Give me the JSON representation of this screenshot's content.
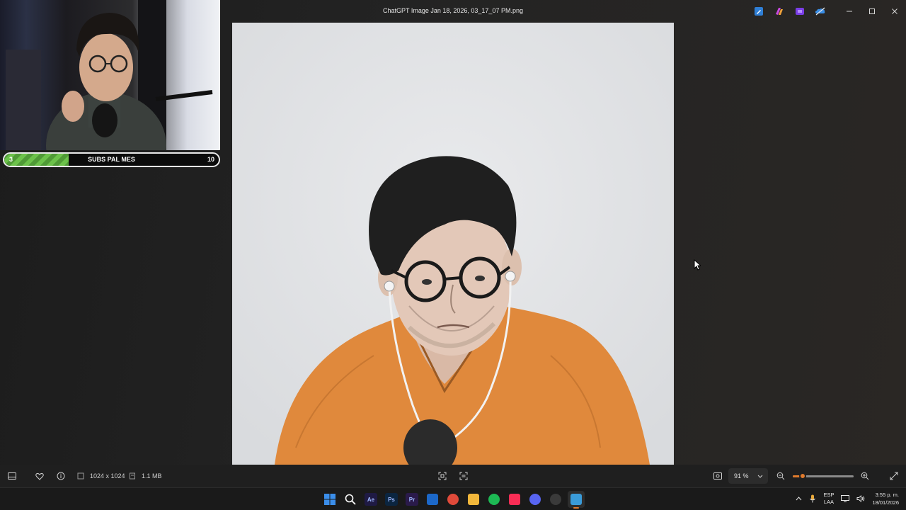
{
  "window": {
    "title": "ChatGPT Image Jan 18, 2026, 03_17_07 PM.png",
    "controls": [
      "minimize-icon",
      "maximize-icon",
      "close-icon"
    ],
    "extension_icons": [
      "pencil-app-icon",
      "copilot-icon",
      "clipchamp-icon",
      "onedrive-icon"
    ]
  },
  "overlay": {
    "subs_goal": {
      "label": "SUBS PAL MES",
      "current": "3",
      "goal": "10",
      "progress": 0.3
    }
  },
  "image": {
    "subject": "colored pencil sketch portrait",
    "hair_color": "#1b1b1b",
    "sweater_color": "#e0893c",
    "paper_color": "#e2e4e6"
  },
  "toolbar": {
    "dimensions": "1024 x 1024",
    "file_size": "1.1 MB",
    "zoom_label": "91 %",
    "zoom_level": 0.91,
    "left_icons": [
      "filmstrip-icon",
      "favorite-heart-icon",
      "info-icon"
    ],
    "center_icons": [
      "crop-icon",
      "visual-search-icon"
    ],
    "right_icons": [
      "fit-to-window-icon",
      "zoom-out-icon",
      "zoom-in-icon",
      "fullscreen-icon"
    ]
  },
  "taskbar": {
    "apps": [
      {
        "name": "start",
        "label": "",
        "color": "#3b8eea"
      },
      {
        "name": "search",
        "label": "",
        "color": "#ffffff"
      },
      {
        "name": "after-effects",
        "label": "Ae",
        "color": "#1f1a44"
      },
      {
        "name": "photoshop",
        "label": "Ps",
        "color": "#0b2540"
      },
      {
        "name": "premiere",
        "label": "Pr",
        "color": "#2a1a4a"
      },
      {
        "name": "outlook",
        "label": "",
        "color": "#1c68c9"
      },
      {
        "name": "chrome",
        "label": "",
        "color": "#e04a3a"
      },
      {
        "name": "file-explorer",
        "label": "",
        "color": "#f2b73b"
      },
      {
        "name": "spotify",
        "label": "",
        "color": "#1db954"
      },
      {
        "name": "itunes",
        "label": "",
        "color": "#fa2d55"
      },
      {
        "name": "discord",
        "label": "",
        "color": "#5865f2"
      },
      {
        "name": "obs",
        "label": "",
        "color": "#3a3a3a"
      },
      {
        "name": "photos",
        "label": "",
        "color": "#3a9bd8"
      }
    ],
    "tray": {
      "language_top": "ESP",
      "language_bottom": "LAA",
      "time": "3:55 p. m.",
      "date": "18/01/2026"
    }
  },
  "colors": {
    "accent": "#e07a2c",
    "progress_green": "#6cc24a"
  }
}
